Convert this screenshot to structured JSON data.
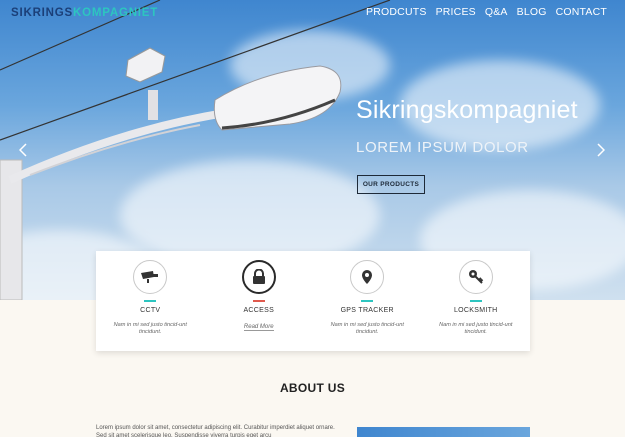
{
  "brand": {
    "part1": "SIKRINGS",
    "part2": "KOMPAGNIET"
  },
  "nav": [
    "PRODCUTS",
    "PRICES",
    "Q&A",
    "BLOG",
    "CONTACT"
  ],
  "hero": {
    "title": "Sikringskompagniet",
    "subtitle": "LOREM IPSUM DOLOR",
    "button": "OUR PRODUCTS",
    "prev_icon": "chevron-left-icon",
    "next_icon": "chevron-right-icon"
  },
  "features": [
    {
      "title": "CCTV",
      "text": "Nam in mi sed justo tincid-unt tincidunt.",
      "icon": "camera-icon"
    },
    {
      "title": "ACCESS",
      "more": "Read More",
      "icon": "lock-icon"
    },
    {
      "title": "GPS TRACKER",
      "text": "Nam in mi sed justo tincid-unt tincidunt.",
      "icon": "map-pin-icon"
    },
    {
      "title": "LOCKSMITH",
      "text": "Nam in mi sed justo tincid-unt tincidunt.",
      "icon": "key-icon"
    }
  ],
  "about": {
    "title": "ABOUT US",
    "text": "Lorem ipsum dolor sit amet, consectetur adipiscing elit. Curabitur imperdiet aliquet ornare. Sed sit amet scelerisque leo. Suspendisse viverra turpis eget arcu"
  },
  "colors": {
    "accent": "#2dc5c0",
    "brand_dark": "#1b3f78",
    "active_line": "#e05a4e",
    "page_bg": "#fbf8f2"
  }
}
